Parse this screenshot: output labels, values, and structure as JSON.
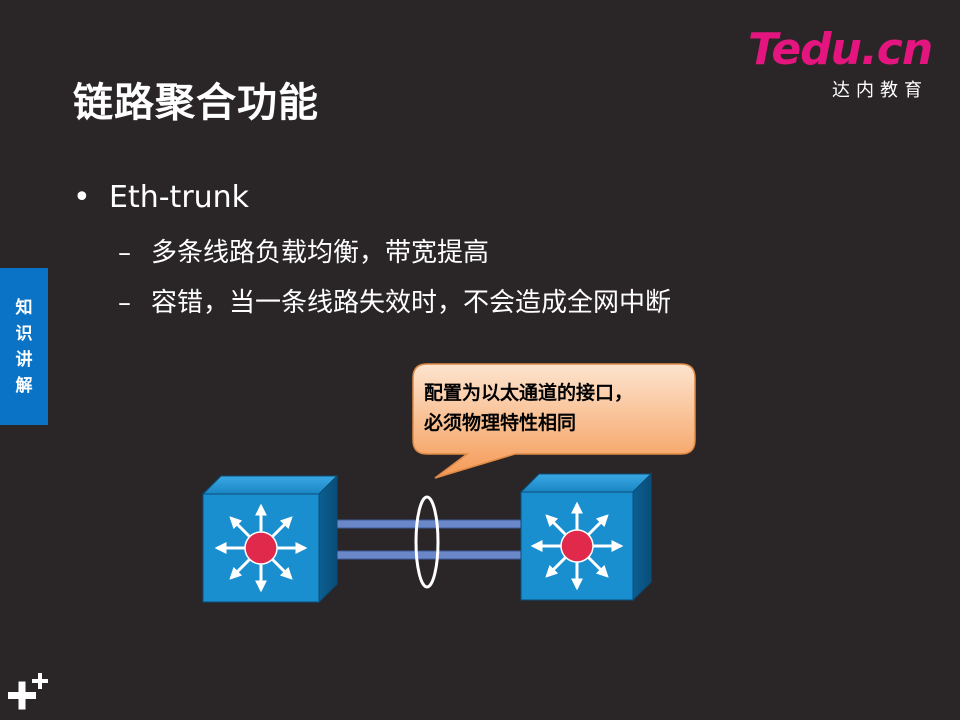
{
  "logo": {
    "main_t": "T",
    "main_rest": "edu",
    "main_dot": ".",
    "main_cn": "cn",
    "sub": "达内教育"
  },
  "title": "链路聚合功能",
  "side_tab": [
    "知",
    "识",
    "讲",
    "解"
  ],
  "bullets": [
    {
      "marker": "•",
      "text": "Eth-trunk",
      "subs": [
        {
          "marker": "–",
          "text": "多条线路负载均衡，带宽提高"
        },
        {
          "marker": "–",
          "text": "容错，当一条线路失效时，不会造成全网中断"
        }
      ]
    }
  ],
  "callout": {
    "lines": [
      "配置为以太通道的接口，",
      "必须物理特性相同"
    ]
  },
  "colors": {
    "background": "#2a2627",
    "side_tab": "#0b73c5",
    "logo_accent": "#e4157e",
    "callout_fill": "#f7a96c",
    "switch_face": "#1a8fd0",
    "switch_center": "#e0294b",
    "link_color": "#6a88c9"
  },
  "diagram": {
    "left_switch_icon": "layer3-switch-icon",
    "right_switch_icon": "layer3-switch-icon",
    "link_count": 2,
    "bundle_marker_icon": "ellipse-bundle-icon"
  },
  "footer_icon": "plus-plus-icon"
}
